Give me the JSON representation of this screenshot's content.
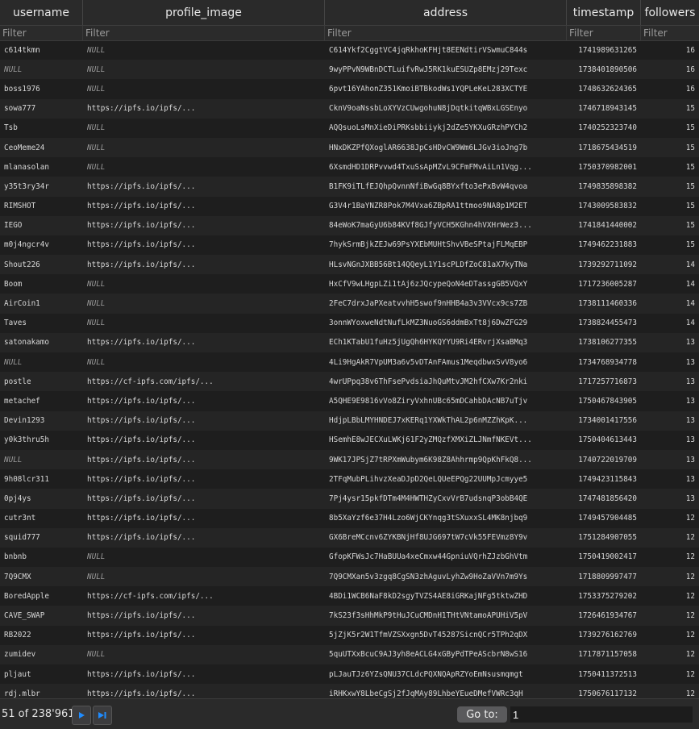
{
  "columns": [
    "username",
    "profile_image",
    "address",
    "timestamp",
    "followers"
  ],
  "filter_placeholder": "Filter",
  "rows": [
    [
      "c614tkmn",
      "NULL",
      "C614Ykf2CggtVC4jqRkhoKFHjt8EENdtirVSwmuC844s",
      "1741989631265",
      "16"
    ],
    [
      "NULL",
      "NULL",
      "9wyPPvN9WBnDCTLuifvRwJ5RK1kuESUZp8EMzj29Texc",
      "1738401890506",
      "16"
    ],
    [
      "boss1976",
      "NULL",
      "6pvt16YAhonZ351KmoiBTBkodWs1YQPLeKeL283XCTYE",
      "1748632624365",
      "16"
    ],
    [
      "sowa777",
      "https://ipfs.io/ipfs/...",
      "CknV9oaNssbLoXYVzCUwgohuN8jDqtkitqWBxLGSEnyo",
      "1746718943145",
      "15"
    ],
    [
      "Tsb",
      "NULL",
      "AQQsuoLsMnXieDiPRKsbbiiykj2dZe5YKXuGRzhPYCh2",
      "1740252323740",
      "15"
    ],
    [
      "CeoMeme24",
      "NULL",
      "HNxDKZPfQXoglAR6638JpCsHDvCW9Wm6LJGv3ioJng7b",
      "1718675434519",
      "15"
    ],
    [
      "mlanasolan",
      "NULL",
      "6XsmdHD1DRPvvwd4TxuSsApMZvL9CFmFMvAiLn1Vqg...",
      "1750370982001",
      "15"
    ],
    [
      "y35t3ry34r",
      "https://ipfs.io/ipfs/...",
      "B1FK9iTLfEJQhpQvnnNfiBwGq8BYxfto3ePxBvW4qvoa",
      "1749835898382",
      "15"
    ],
    [
      "RIMSHOT",
      "https://ipfs.io/ipfs/...",
      "G3V4r1BaYNZR8Pok7M4Vxa6ZBpRA1ttmoo9NA8p1M2ET",
      "1743009583832",
      "15"
    ],
    [
      "IEGO",
      "https://ipfs.io/ipfs/...",
      "84eWoK7maGyU6b84KVf8GJfyVCH5KGhn4hVXHrWez3...",
      "1741841440002",
      "15"
    ],
    [
      "m0j4ngcr4v",
      "https://ipfs.io/ipfs/...",
      "7hykSrmBjkZEJw69PsYXEbMUHtShvVBeSPtajFLMqEBP",
      "1749462231883",
      "15"
    ],
    [
      "Shout226",
      "https://ipfs.io/ipfs/...",
      "HLsvNGnJXBB56Bt14QQeyL1Y1scPLDfZoC81aX7kyTNa",
      "1739292711092",
      "14"
    ],
    [
      "Boom",
      "NULL",
      "HxCfV9wLHgpLZi1tAj6zJQcypeQoN4eDTassgGB5VQxY",
      "1717236005287",
      "14"
    ],
    [
      "AirCoin1",
      "NULL",
      "2FeC7drxJaPXeatvvhH5swof9nHHB4a3v3VVcx9cs7ZB",
      "1738111460336",
      "14"
    ],
    [
      "Taves",
      "NULL",
      "3onnWYoxweNdtNufLkMZ3NuoGS6ddmBxTt8j6DwZFG29",
      "1738824455473",
      "14"
    ],
    [
      "satonakamo",
      "https://ipfs.io/ipfs/...",
      "ECh1KTabU1fuHz5jUgQh6HYKQYYU9Ri4ERvrjXsaBMq3",
      "1738106277355",
      "13"
    ],
    [
      "NULL",
      "NULL",
      "4Li9HgAkR7VpUM3a6v5vDTAnFAmus1MeqdbwxSvV8yo6",
      "1734768934778",
      "13"
    ],
    [
      "postle",
      "https://cf-ipfs.com/ipfs/...",
      "4wrUPpq38v6ThFsePvdsiaJhQuMtvJM2hfCXw7Kr2nki",
      "1717257716873",
      "13"
    ],
    [
      "metachef",
      "https://ipfs.io/ipfs/...",
      "A5QHE9E9816vVo8ZiryVxhnUBc65mDCahbDAcNB7uTjv",
      "1750467843905",
      "13"
    ],
    [
      "Devin1293",
      "https://ipfs.io/ipfs/...",
      "HdjpLBbLMYHNDEJ7xKERq1YXWkThAL2p6nMZZhKpK...",
      "1734001417556",
      "13"
    ],
    [
      "y0k3thru5h",
      "https://ipfs.io/ipfs/...",
      "HSemhE8wJECXuLWKj61F2yZMQzfXMXiZLJNmfNKEVt...",
      "1750404613443",
      "13"
    ],
    [
      "NULL",
      "https://ipfs.io/ipfs/...",
      "9WK17JPSjZ7tRPXmWubym6K98Z8Ahhrmp9QpKhFkQ8...",
      "1740722019709",
      "13"
    ],
    [
      "9h08lcr311",
      "https://ipfs.io/ipfs/...",
      "2TFqMubPLihvzXeaDJpD2QeLQUeEPQg22UUMpJcmyye5",
      "1749423115843",
      "13"
    ],
    [
      "0pj4ys",
      "https://ipfs.io/ipfs/...",
      "7Pj4ysr15pkfDTm4M4HWTHZyCxvVrB7udsnqP3obB4QE",
      "1747481856420",
      "13"
    ],
    [
      "cutr3nt",
      "https://ipfs.io/ipfs/...",
      "8b5XaYzf6e37H4Lzo6WjCKYnqg3tSXuxxSL4MK8njbq9",
      "1749457904485",
      "12"
    ],
    [
      "squid777",
      "https://ipfs.io/ipfs/...",
      "GX6BreMCcnv6ZYKBNjHf8UJG697tW7cVk55FEVmz8Y9v",
      "1751284907055",
      "12"
    ],
    [
      "bnbnb",
      "NULL",
      "GfopKFWsJc7HaBUUa4xeCmxw44GpniuVQrhZJzbGhVtm",
      "1750419002417",
      "12"
    ],
    [
      "7Q9CMX",
      "NULL",
      "7Q9CMXan5v3zgq8CgSN3zhAguvLyhZw9HoZaVVn7m9Ys",
      "1718809997477",
      "12"
    ],
    [
      "BoredApple",
      "https://cf-ipfs.com/ipfs/...",
      "4BDi1WCB6NaF8kD2sgyTVZS4AE8iGRKajNFg5tktwZHD",
      "1753375279202",
      "12"
    ],
    [
      "CAVE_SWAP",
      "https://ipfs.io/ipfs/...",
      "7kS23f3sHhMkP9tHuJCuCMDnH1THtVNtamoAPUHiV5pV",
      "1726461934767",
      "12"
    ],
    [
      "RB2022",
      "https://ipfs.io/ipfs/...",
      "5jZjK5r2W1TfmVZSXxgn5DvT45287SicnQCr5TPh2qDX",
      "1739276162769",
      "12"
    ],
    [
      "zumidev",
      "NULL",
      "5quUTXxBcuC9AJ3yh8eACLG4xGByPdTPeAScbrN8wS16",
      "1717871157058",
      "12"
    ],
    [
      "pljaut",
      "https://ipfs.io/ipfs/...",
      "pLJauTJz6YZsQNU37CLdcPQXNQApRZYoEmNsusmqmgt",
      "1750411372513",
      "12"
    ],
    [
      "rdj.mlbr",
      "https://ipfs.io/ipfs/...",
      "iRHKxwY8LbeCgSj2fJqMAy89LhbeYEueDMefVWRc3qH",
      "1750676117132",
      "12"
    ]
  ],
  "footer": {
    "count_text": "51 of 238'961",
    "goto_label": "Go to:",
    "goto_value": "1",
    "accent_color": "#1f8cff"
  }
}
